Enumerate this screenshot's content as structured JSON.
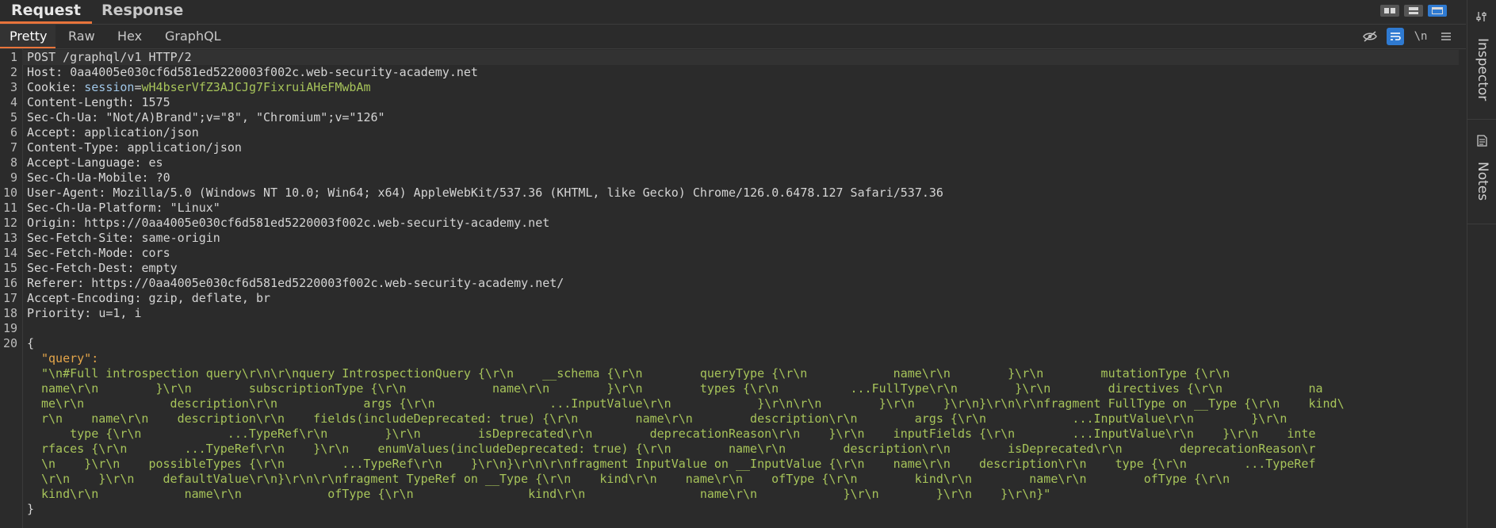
{
  "top_tabs": [
    "Request",
    "Response"
  ],
  "sub_tabs": [
    "Pretty",
    "Raw",
    "Hex",
    "GraphQL"
  ],
  "toolbar": {
    "newline_label": "\\n"
  },
  "sidebar": {
    "inspector": "Inspector",
    "notes": "Notes"
  },
  "line_numbers": [
    "1",
    "2",
    "3",
    "4",
    "5",
    "6",
    "7",
    "8",
    "9",
    "10",
    "11",
    "12",
    "13",
    "14",
    "15",
    "16",
    "17",
    "18",
    "19",
    "20"
  ],
  "request": {
    "request_line": "POST /graphql/v1 HTTP/2",
    "headers": [
      {
        "name": "Host",
        "value": "0aa4005e030cf6d581ed5220003f002c.web-security-academy.net"
      },
      {
        "name": "Cookie",
        "value": ""
      },
      {
        "name": "Content-Length",
        "value": "1575"
      },
      {
        "name": "Sec-Ch-Ua",
        "value": "\"Not/A)Brand\";v=\"8\", \"Chromium\";v=\"126\""
      },
      {
        "name": "Accept",
        "value": "application/json"
      },
      {
        "name": "Content-Type",
        "value": "application/json"
      },
      {
        "name": "Accept-Language",
        "value": "es"
      },
      {
        "name": "Sec-Ch-Ua-Mobile",
        "value": "?0"
      },
      {
        "name": "User-Agent",
        "value": "Mozilla/5.0 (Windows NT 10.0; Win64; x64) AppleWebKit/537.36 (KHTML, like Gecko) Chrome/126.0.6478.127 Safari/537.36"
      },
      {
        "name": "Sec-Ch-Ua-Platform",
        "value": "\"Linux\""
      },
      {
        "name": "Origin",
        "value": "https://0aa4005e030cf6d581ed5220003f002c.web-security-academy.net"
      },
      {
        "name": "Sec-Fetch-Site",
        "value": "same-origin"
      },
      {
        "name": "Sec-Fetch-Mode",
        "value": "cors"
      },
      {
        "name": "Sec-Fetch-Dest",
        "value": "empty"
      },
      {
        "name": "Referer",
        "value": "https://0aa4005e030cf6d581ed5220003f002c.web-security-academy.net/"
      },
      {
        "name": "Accept-Encoding",
        "value": "gzip, deflate, br"
      },
      {
        "name": "Priority",
        "value": "u=1, i"
      }
    ],
    "cookie_name": "session",
    "cookie_value": "wH4bserVfZ3AJCJg7FixruiAHeFMwbAm",
    "body_open": "{",
    "body_key": "\"query\":",
    "body_value_lines": [
      "\"\\n#Full introspection query\\r\\n\\r\\nquery IntrospectionQuery {\\r\\n    __schema {\\r\\n        queryType {\\r\\n            name\\r\\n        }\\r\\n        mutationType {\\r\\n",
      "name\\r\\n        }\\r\\n        subscriptionType {\\r\\n            name\\r\\n        }\\r\\n        types {\\r\\n          ...FullType\\r\\n        }\\r\\n        directives {\\r\\n            na",
      "me\\r\\n            description\\r\\n            args {\\r\\n                ...InputValue\\r\\n            }\\r\\n\\r\\n        }\\r\\n    }\\r\\n}\\r\\n\\r\\nfragment FullType on __Type {\\r\\n    kind\\",
      "r\\n    name\\r\\n    description\\r\\n    fields(includeDeprecated: true) {\\r\\n        name\\r\\n        description\\r\\n        args {\\r\\n            ...InputValue\\r\\n        }\\r\\n",
      "    type {\\r\\n            ...TypeRef\\r\\n        }\\r\\n        isDeprecated\\r\\n        deprecationReason\\r\\n    }\\r\\n    inputFields {\\r\\n        ...InputValue\\r\\n    }\\r\\n    inte",
      "rfaces {\\r\\n        ...TypeRef\\r\\n    }\\r\\n    enumValues(includeDeprecated: true) {\\r\\n        name\\r\\n        description\\r\\n        isDeprecated\\r\\n        deprecationReason\\r",
      "\\n    }\\r\\n    possibleTypes {\\r\\n        ...TypeRef\\r\\n    }\\r\\n}\\r\\n\\r\\nfragment InputValue on __InputValue {\\r\\n    name\\r\\n    description\\r\\n    type {\\r\\n        ...TypeRef",
      "\\r\\n    }\\r\\n    defaultValue\\r\\n}\\r\\n\\r\\nfragment TypeRef on __Type {\\r\\n    kind\\r\\n    name\\r\\n    ofType {\\r\\n        kind\\r\\n        name\\r\\n        ofType {\\r\\n",
      "kind\\r\\n            name\\r\\n            ofType {\\r\\n                kind\\r\\n                name\\r\\n            }\\r\\n        }\\r\\n    }\\r\\n}\""
    ],
    "body_close": "}"
  },
  "colors": {
    "accent": "#e8743b",
    "active_blue": "#2f7ad1",
    "json_key": "#e5a64a",
    "json_string": "#a7c45a",
    "cookie_name": "#9fc6e7"
  }
}
